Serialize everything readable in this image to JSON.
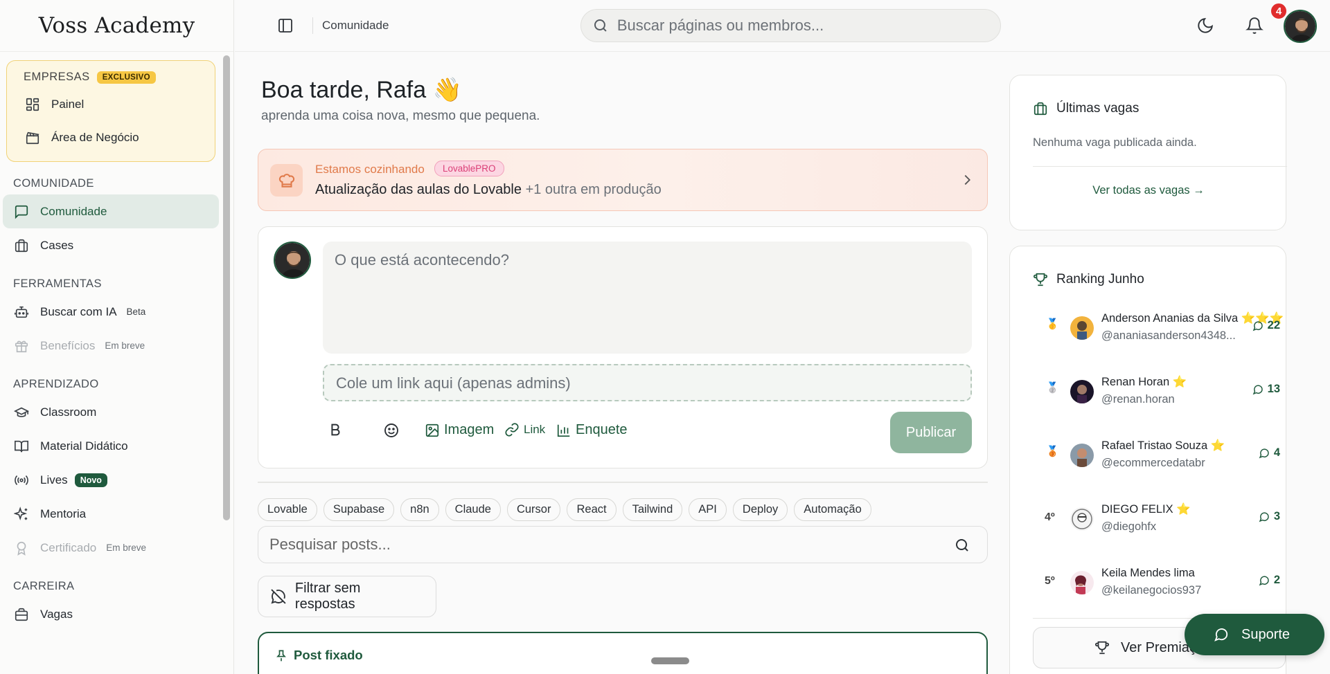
{
  "brand": "Voss Academy",
  "topbar": {
    "breadcrumb": "Comunidade",
    "search_placeholder": "Buscar páginas ou membros...",
    "notification_count": "4"
  },
  "sidebar": {
    "business": {
      "label": "EMPRESAS",
      "badge": "EXCLUSIVO",
      "items": [
        {
          "label": "Painel",
          "icon": "grid-icon"
        },
        {
          "label": "Área de Negócio",
          "icon": "clapperboard-icon"
        }
      ]
    },
    "sections": [
      {
        "title": "COMUNIDADE",
        "items": [
          {
            "label": "Comunidade",
            "icon": "message-square-icon",
            "active": true
          },
          {
            "label": "Cases",
            "icon": "briefcase-icon"
          }
        ]
      },
      {
        "title": "FERRAMENTAS",
        "items": [
          {
            "label": "Buscar com IA",
            "icon": "bot-icon",
            "tag": "Beta"
          },
          {
            "label": "Benefícios",
            "icon": "gift-icon",
            "tag": "Em breve",
            "disabled": true
          }
        ]
      },
      {
        "title": "APRENDIZADO",
        "items": [
          {
            "label": "Classroom",
            "icon": "graduation-cap-icon"
          },
          {
            "label": "Material Didático",
            "icon": "book-open-icon"
          },
          {
            "label": "Lives",
            "icon": "radio-icon",
            "badge": "Novo"
          },
          {
            "label": "Mentoria",
            "icon": "sparkles-icon"
          },
          {
            "label": "Certificado",
            "icon": "award-icon",
            "tag": "Em breve",
            "disabled": true
          }
        ]
      },
      {
        "title": "CARREIRA",
        "items": [
          {
            "label": "Vagas",
            "icon": "briefcase-icon"
          }
        ]
      }
    ]
  },
  "main": {
    "greeting": "Boa tarde, Rafa 👋",
    "subtitle": "aprenda uma coisa nova, mesmo que pequena.",
    "banner": {
      "kicker": "Estamos cozinhando",
      "badge": "LovablePRO",
      "title": "Atualização das aulas do Lovable",
      "more": "+1 outra em produção"
    },
    "composer": {
      "placeholder": "O que está acontecendo?",
      "link_placeholder": "Cole um link aqui (apenas admins)",
      "image_label": "Imagem",
      "link_label": "Link",
      "poll_label": "Enquete",
      "publish_label": "Publicar"
    },
    "tags": [
      "Lovable",
      "Supabase",
      "n8n",
      "Claude",
      "Cursor",
      "React",
      "Tailwind",
      "API",
      "Deploy",
      "Automação"
    ],
    "post_search_placeholder": "Pesquisar posts...",
    "filter_label": "Filtrar sem respostas",
    "pinned_label": "Post fixado"
  },
  "jobs": {
    "title": "Últimas vagas",
    "empty": "Nenhuma vaga publicada ainda.",
    "link": "Ver todas as vagas →"
  },
  "ranking": {
    "title": "Ranking Junho",
    "entries": [
      {
        "pos": "🥇",
        "name": "Anderson Ananias da Silva ⭐⭐⭐",
        "user": "@ananiasanderson4348...",
        "score": "22"
      },
      {
        "pos": "🥈",
        "name": "Renan Horan ⭐",
        "user": "@renan.horan",
        "score": "13"
      },
      {
        "pos": "🥉",
        "name": "Rafael Tristao Souza ⭐",
        "user": "@ecommercedatabr",
        "score": "4"
      },
      {
        "pos": "4º",
        "name": "DIEGO FELIX ⭐",
        "user": "@diegohfx",
        "score": "3"
      },
      {
        "pos": "5º",
        "name": "Keila Mendes lima",
        "user": "@keilanegocios937",
        "score": "2"
      }
    ],
    "button": "Ver Premiações"
  },
  "support_label": "Suporte",
  "colors": {
    "brand_green": "#1f5a3d",
    "accent_orange": "#e07a4a",
    "badge_yellow": "#f6c744",
    "notif_red": "#e02d2d"
  }
}
